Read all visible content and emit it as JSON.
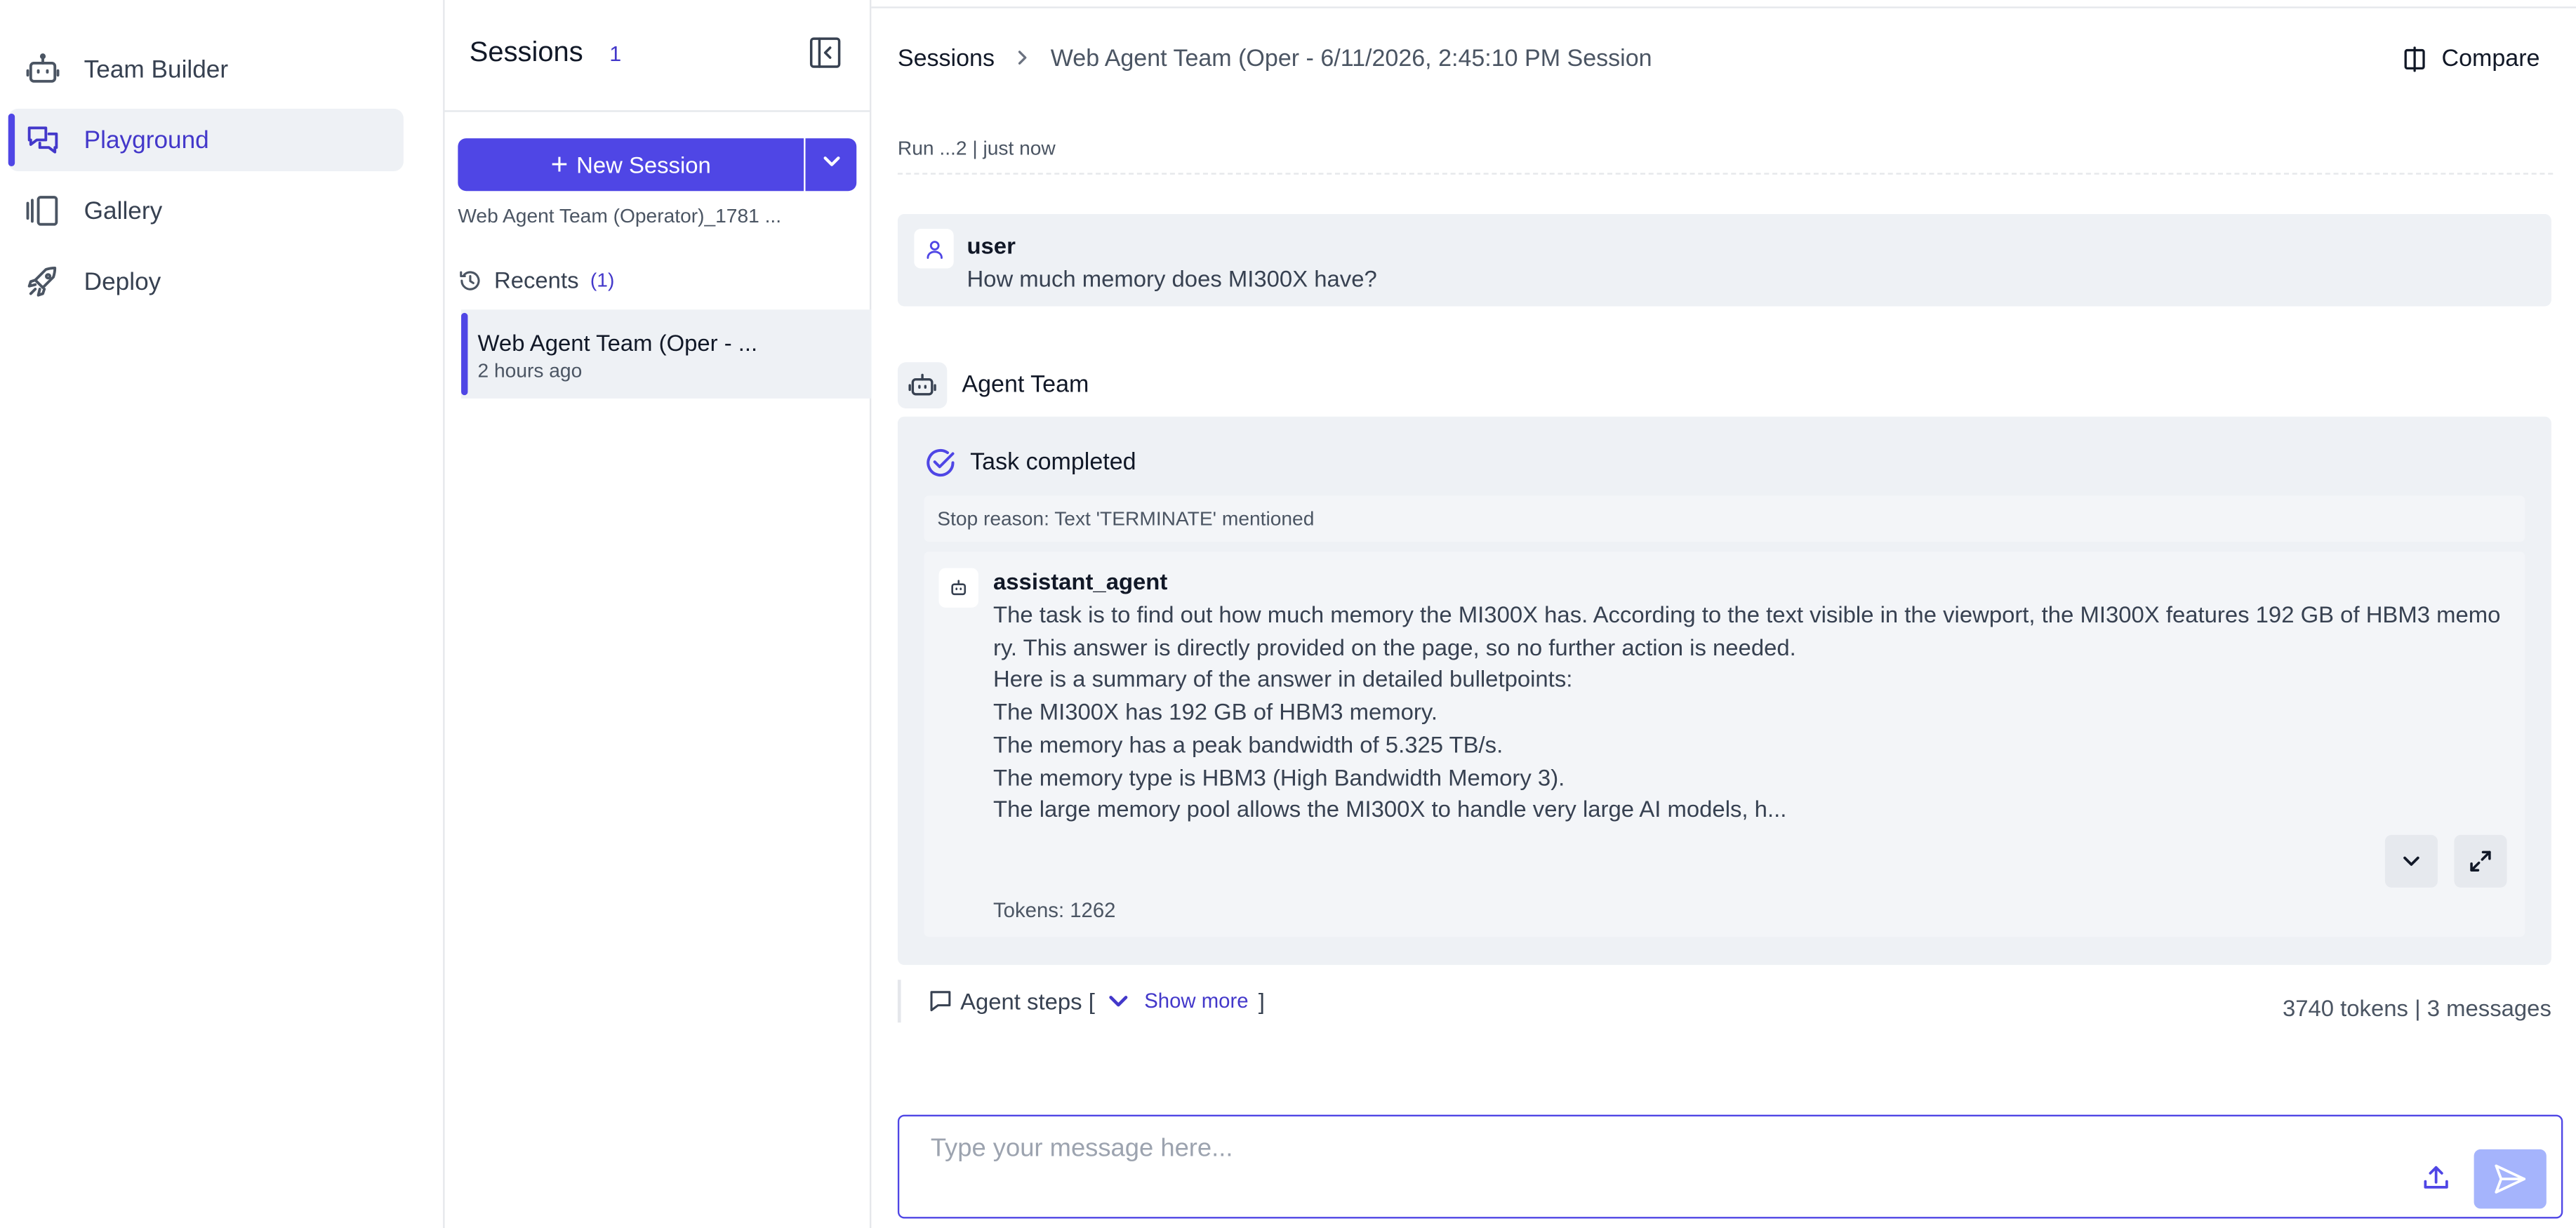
{
  "nav": {
    "items": [
      {
        "label": "Team Builder",
        "icon": "robot-icon"
      },
      {
        "label": "Playground",
        "icon": "chat-bubbles-icon"
      },
      {
        "label": "Gallery",
        "icon": "gallery-icon"
      },
      {
        "label": "Deploy",
        "icon": "rocket-icon"
      }
    ],
    "active_color": "#4f46e5"
  },
  "sessions": {
    "title": "Sessions",
    "count": "1",
    "new_session_label": "New Session",
    "team_name": "Web Agent Team (Operator)_1781 ...",
    "recents_label": "Recents",
    "recents_count": "(1)",
    "recent_items": [
      {
        "title": "Web Agent Team (Oper - ...",
        "time": "2 hours ago"
      }
    ]
  },
  "main": {
    "breadcrumb_root": "Sessions",
    "breadcrumb_current": "Web Agent Team (Oper - 6/11/2026, 2:45:10 PM Session",
    "compare_label": "Compare",
    "run_info": "Run ...2 | just now",
    "user_message": {
      "sender": "user",
      "text": "How much memory does MI300X have?"
    },
    "agent_team_label": "Agent Team",
    "task_status": "Task completed",
    "stop_reason": "Stop reason: Text 'TERMINATE' mentioned",
    "assistant": {
      "name": "assistant_agent",
      "lines": [
        "The task is to find out how much memory the MI300X has. According to the text visible in the viewport, the MI300X features 192 GB of HBM3 memo",
        "ry. This answer is directly provided on the page, so no further action is needed.",
        "Here is a summary of the answer in detailed bulletpoints:",
        "The MI300X has 192 GB of HBM3 memory.",
        "The memory has a peak bandwidth of 5.325 TB/s.",
        "The memory type is HBM3 (High Bandwidth Memory 3).",
        "The large memory pool allows the MI300X to handle very large AI models, h..."
      ],
      "tokens": "Tokens: 1262"
    },
    "agent_steps_label": "Agent steps [",
    "show_more_label": "Show more",
    "closing_bracket": "]",
    "stats": "3740 tokens | 3 messages",
    "input_placeholder": "Type your message here...",
    "accent_color": "#4f46e5",
    "send_button_color": "#a5b4fc"
  }
}
